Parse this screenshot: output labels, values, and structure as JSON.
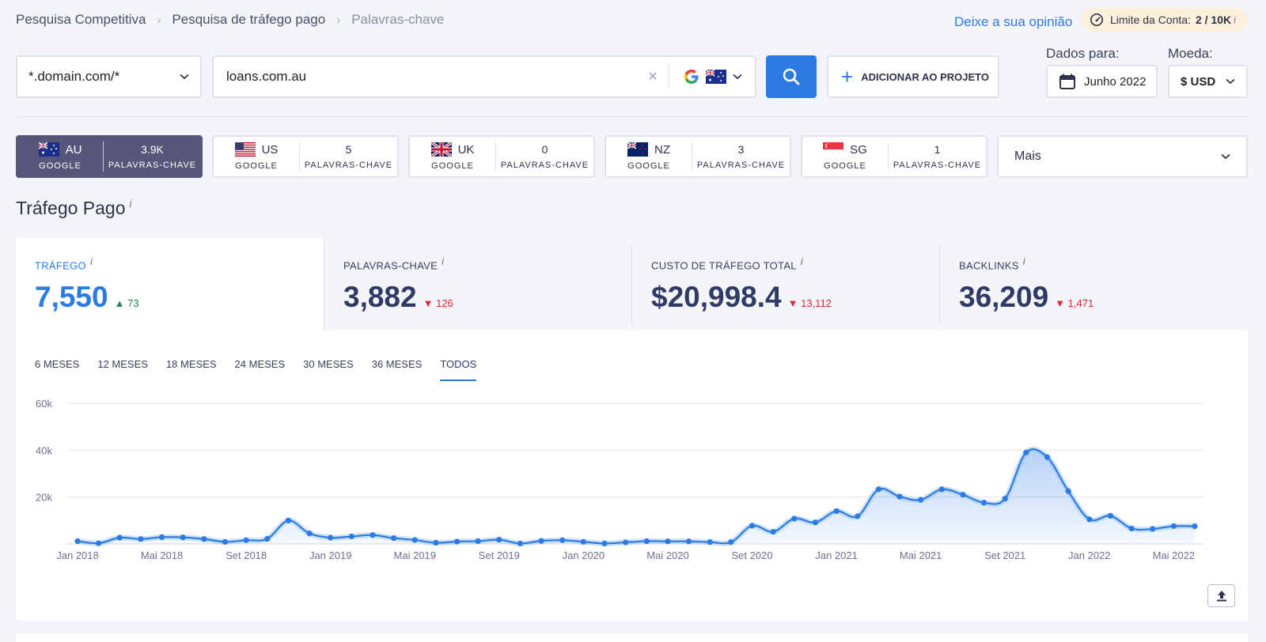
{
  "breadcrumbs": [
    "Pesquisa Competitiva",
    "Pesquisa de tráfego pago",
    "Palavras-chave"
  ],
  "feedback_link": "Deixe a sua opinião",
  "account_limit": {
    "label": "Limite da Conta:",
    "value": "2 / 10K",
    "info": "i"
  },
  "domain_mode": "*.domain.com/*",
  "search": {
    "value": "loans.com.au",
    "clear_icon": "close-icon",
    "engine_icon": "google-icon",
    "country_flag": "au-flag"
  },
  "add_project_label": "ADICIONAR AO PROJETO",
  "data_for": {
    "label": "Dados para:",
    "value": "Junho 2022"
  },
  "currency": {
    "label": "Moeda:",
    "value": "$ USD"
  },
  "countries": [
    {
      "code": "AU",
      "engine": "GOOGLE",
      "count": "3.9K",
      "unit": "PALAVRAS-CHAVE",
      "active": true
    },
    {
      "code": "US",
      "engine": "GOOGLE",
      "count": "5",
      "unit": "PALAVRAS-CHAVE",
      "active": false
    },
    {
      "code": "UK",
      "engine": "GOOGLE",
      "count": "0",
      "unit": "PALAVRAS-CHAVE",
      "active": false
    },
    {
      "code": "NZ",
      "engine": "GOOGLE",
      "count": "3",
      "unit": "PALAVRAS-CHAVE",
      "active": false
    },
    {
      "code": "SG",
      "engine": "GOOGLE",
      "count": "1",
      "unit": "PALAVRAS-CHAVE",
      "active": false
    }
  ],
  "more_label": "Mais",
  "section_title": "Tráfego Pago",
  "info_mark": "i",
  "metrics": [
    {
      "label": "TRÁFEGO",
      "value": "7,550",
      "delta": "73",
      "direction": "up"
    },
    {
      "label": "PALAVRAS-CHAVE",
      "value": "3,882",
      "delta": "126",
      "direction": "down"
    },
    {
      "label": "CUSTO DE TRÁFEGO TOTAL",
      "value": "$20,998.4",
      "delta": "13,112",
      "direction": "down"
    },
    {
      "label": "BACKLINKS",
      "value": "36,209",
      "delta": "1,471",
      "direction": "down"
    }
  ],
  "period_tabs": [
    "6 MESES",
    "12 MESES",
    "18 MESES",
    "24 MESES",
    "30 MESES",
    "36 MESES",
    "TODOS"
  ],
  "active_tab": "TODOS",
  "colors": {
    "accent": "#2c7be5",
    "active_country": "#56557a",
    "up": "#1e8a52",
    "down": "#e0243c"
  },
  "chart_data": {
    "type": "area",
    "x": [
      "Jan 2018",
      "Fev 2018",
      "Mar 2018",
      "Abr 2018",
      "Mai 2018",
      "Jun 2018",
      "Jul 2018",
      "Ago 2018",
      "Set 2018",
      "Out 2018",
      "Nov 2018",
      "Dez 2018",
      "Jan 2019",
      "Fev 2019",
      "Mar 2019",
      "Abr 2019",
      "Mai 2019",
      "Jun 2019",
      "Jul 2019",
      "Ago 2019",
      "Set 2019",
      "Out 2019",
      "Nov 2019",
      "Dez 2019",
      "Jan 2020",
      "Fev 2020",
      "Mar 2020",
      "Abr 2020",
      "Mai 2020",
      "Jun 2020",
      "Jul 2020",
      "Ago 2020",
      "Set 2020",
      "Out 2020",
      "Nov 2020",
      "Dez 2020",
      "Jan 2021",
      "Fev 2021",
      "Mar 2021",
      "Abr 2021",
      "Mai 2021",
      "Jun 2021",
      "Jul 2021",
      "Ago 2021",
      "Set 2021",
      "Out 2021",
      "Nov 2021",
      "Dez 2021",
      "Jan 2022",
      "Fev 2022",
      "Mar 2022",
      "Abr 2022",
      "Mai 2022",
      "Jun 2022"
    ],
    "series": [
      {
        "values": [
          1200,
          300,
          2700,
          2100,
          2900,
          2800,
          2100,
          900,
          1600,
          2200,
          10000,
          4500,
          2700,
          3200,
          3800,
          2500,
          1700,
          500,
          1000,
          1200,
          1800,
          200,
          1300,
          1600,
          900,
          200,
          700,
          1200,
          1100,
          1100,
          800,
          800,
          7800,
          5200,
          10800,
          9200,
          14000,
          11800,
          23300,
          20200,
          18800,
          23300,
          21000,
          17600,
          19300,
          39000,
          37000,
          22500,
          10500,
          12000,
          6600,
          6400,
          7600,
          7550
        ]
      }
    ],
    "x_tick_labels": [
      "Jan 2018",
      "Mai 2018",
      "Set 2018",
      "Jan 2019",
      "Mai 2019",
      "Set 2019",
      "Jan 2020",
      "Mai 2020",
      "Set 2020",
      "Jan 2021",
      "Mai 2021",
      "Set 2021",
      "Jan 2022",
      "Mai 2022"
    ],
    "y_tick_labels": [
      "60k",
      "40k",
      "20k"
    ],
    "ylim": [
      0,
      60000
    ],
    "grid": true,
    "color": "#2c7be5"
  },
  "export_icon": "upload-icon"
}
